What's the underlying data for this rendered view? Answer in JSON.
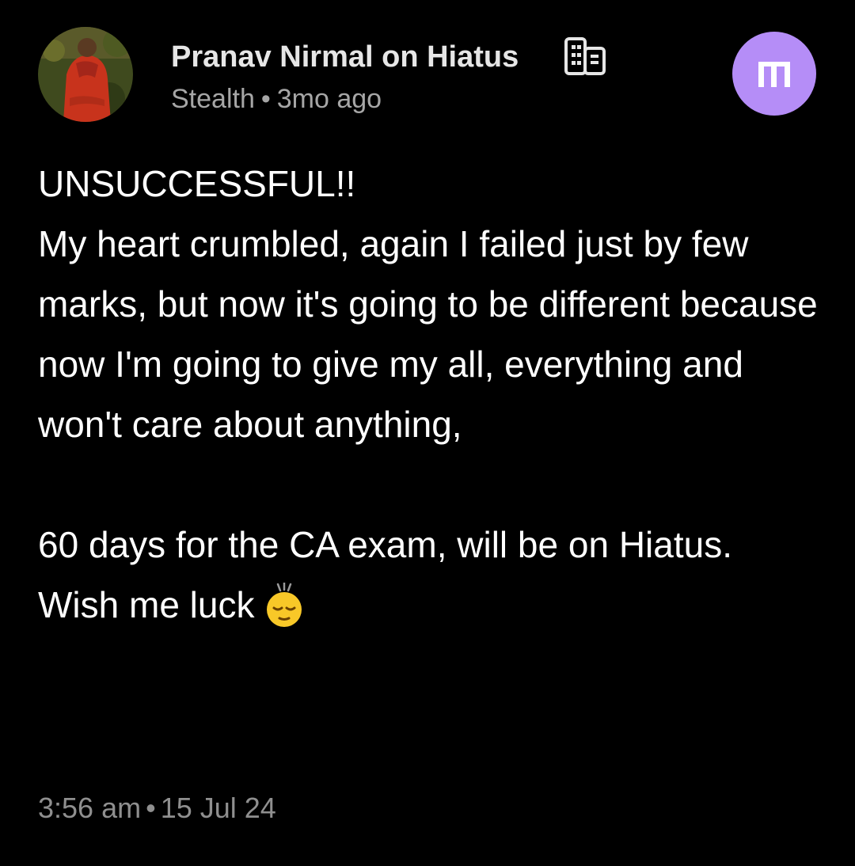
{
  "post": {
    "author": {
      "name": "Pranav Nirmal on Hiatus",
      "company": "Stealth",
      "separator": "•",
      "time_ago": "3mo ago",
      "company_icon": "building-icon",
      "avatar_icon": "profile-photo"
    },
    "badge": {
      "icon": "m-logo-icon",
      "color": "#b58df7"
    },
    "body": {
      "line1": "UNSUCCESSFUL!!",
      "line2": "My heart crumbled, again I failed just by few marks, but now it's going to be different because now I'm going to give my all, everything and won't care about anything,",
      "line3": "60 days for the CA exam, will be on Hiatus.",
      "line4": "Wish me luck",
      "emoji": "sleepy-face-icon"
    },
    "footer": {
      "time": "3:56 am",
      "separator": "•",
      "date": "15 Jul 24"
    }
  }
}
